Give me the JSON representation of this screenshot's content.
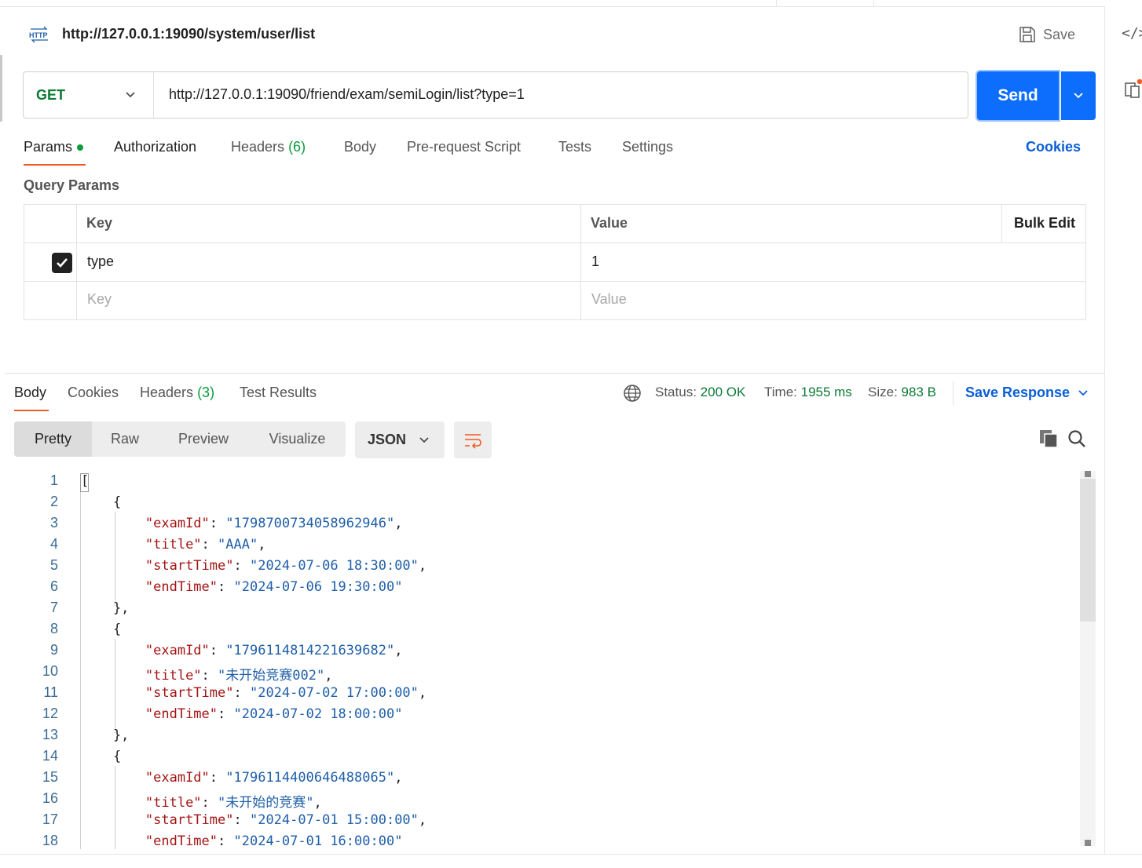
{
  "request": {
    "title": "http://127.0.0.1:19090/system/user/list",
    "save_label": "Save",
    "method": "GET",
    "url": "http://127.0.0.1:19090/friend/exam/semiLogin/list?type=1",
    "send_label": "Send"
  },
  "request_tabs": {
    "params": "Params",
    "authorization": "Authorization",
    "headers": "Headers",
    "headers_count": "(6)",
    "body": "Body",
    "prerequest": "Pre-request Script",
    "tests": "Tests",
    "settings": "Settings",
    "cookies": "Cookies"
  },
  "query_params": {
    "label": "Query Params",
    "headers": {
      "key": "Key",
      "value": "Value",
      "bulk_edit": "Bulk Edit"
    },
    "rows": [
      {
        "enabled": true,
        "key": "type",
        "value": "1"
      }
    ],
    "placeholder": {
      "key": "Key",
      "value": "Value"
    }
  },
  "response_tabs": {
    "body": "Body",
    "cookies": "Cookies",
    "headers": "Headers",
    "headers_count": "(3)",
    "test_results": "Test Results"
  },
  "response_status": {
    "status_label": "Status:",
    "status_value": "200 OK",
    "time_label": "Time:",
    "time_value": "1955 ms",
    "size_label": "Size:",
    "size_value": "983 B",
    "save_response": "Save Response"
  },
  "view_modes": [
    "Pretty",
    "Raw",
    "Preview",
    "Visualize"
  ],
  "format": "JSON",
  "code_lines": [
    [
      "1",
      [
        [
          "p",
          "["
        ]
      ]
    ],
    [
      "2",
      [
        [
          "p",
          "    {"
        ]
      ]
    ],
    [
      "3",
      [
        [
          "p",
          "        "
        ],
        [
          "k",
          "\"examId\""
        ],
        [
          "p",
          ": "
        ],
        [
          "s",
          "\"1798700734058962946\""
        ],
        [
          "p",
          ","
        ]
      ]
    ],
    [
      "4",
      [
        [
          "p",
          "        "
        ],
        [
          "k",
          "\"title\""
        ],
        [
          "p",
          ": "
        ],
        [
          "s",
          "\"AAA\""
        ],
        [
          "p",
          ","
        ]
      ]
    ],
    [
      "5",
      [
        [
          "p",
          "        "
        ],
        [
          "k",
          "\"startTime\""
        ],
        [
          "p",
          ": "
        ],
        [
          "s",
          "\"2024-07-06 18:30:00\""
        ],
        [
          "p",
          ","
        ]
      ]
    ],
    [
      "6",
      [
        [
          "p",
          "        "
        ],
        [
          "k",
          "\"endTime\""
        ],
        [
          "p",
          ": "
        ],
        [
          "s",
          "\"2024-07-06 19:30:00\""
        ]
      ]
    ],
    [
      "7",
      [
        [
          "p",
          "    },"
        ]
      ]
    ],
    [
      "8",
      [
        [
          "p",
          "    {"
        ]
      ]
    ],
    [
      "9",
      [
        [
          "p",
          "        "
        ],
        [
          "k",
          "\"examId\""
        ],
        [
          "p",
          ": "
        ],
        [
          "s",
          "\"1796114814221639682\""
        ],
        [
          "p",
          ","
        ]
      ]
    ],
    [
      "10",
      [
        [
          "p",
          "        "
        ],
        [
          "k",
          "\"title\""
        ],
        [
          "p",
          ": "
        ],
        [
          "s",
          "\"未开始竞赛002\""
        ],
        [
          "p",
          ","
        ]
      ]
    ],
    [
      "11",
      [
        [
          "p",
          "        "
        ],
        [
          "k",
          "\"startTime\""
        ],
        [
          "p",
          ": "
        ],
        [
          "s",
          "\"2024-07-02 17:00:00\""
        ],
        [
          "p",
          ","
        ]
      ]
    ],
    [
      "12",
      [
        [
          "p",
          "        "
        ],
        [
          "k",
          "\"endTime\""
        ],
        [
          "p",
          ": "
        ],
        [
          "s",
          "\"2024-07-02 18:00:00\""
        ]
      ]
    ],
    [
      "13",
      [
        [
          "p",
          "    },"
        ]
      ]
    ],
    [
      "14",
      [
        [
          "p",
          "    {"
        ]
      ]
    ],
    [
      "15",
      [
        [
          "p",
          "        "
        ],
        [
          "k",
          "\"examId\""
        ],
        [
          "p",
          ": "
        ],
        [
          "s",
          "\"1796114400646488065\""
        ],
        [
          "p",
          ","
        ]
      ]
    ],
    [
      "16",
      [
        [
          "p",
          "        "
        ],
        [
          "k",
          "\"title\""
        ],
        [
          "p",
          ": "
        ],
        [
          "s",
          "\"未开始的竞赛\""
        ],
        [
          "p",
          ","
        ]
      ]
    ],
    [
      "17",
      [
        [
          "p",
          "        "
        ],
        [
          "k",
          "\"startTime\""
        ],
        [
          "p",
          ": "
        ],
        [
          "s",
          "\"2024-07-01 15:00:00\""
        ],
        [
          "p",
          ","
        ]
      ]
    ],
    [
      "18",
      [
        [
          "p",
          "        "
        ],
        [
          "k",
          "\"endTime\""
        ],
        [
          "p",
          ": "
        ],
        [
          "s",
          "\"2024-07-01 16:00:00\""
        ]
      ]
    ]
  ]
}
